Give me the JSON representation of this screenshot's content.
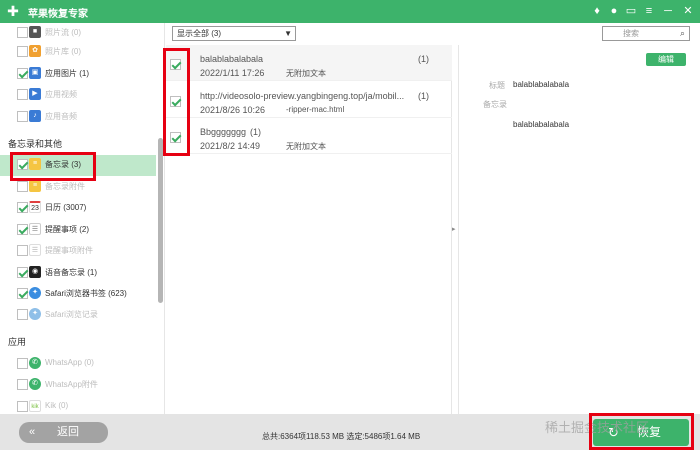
{
  "app": {
    "title": "苹果恢复专家",
    "logo_glyph": "✚"
  },
  "window_controls": [
    {
      "name": "diamond-icon",
      "glyph": "♦"
    },
    {
      "name": "user-icon",
      "glyph": "●"
    },
    {
      "name": "chat-icon",
      "glyph": "▭"
    },
    {
      "name": "menu-icon",
      "glyph": "≡"
    },
    {
      "name": "minimize-icon",
      "glyph": "─"
    },
    {
      "name": "close-icon",
      "glyph": "✕"
    }
  ],
  "sidebar": {
    "items_top": [
      {
        "label": "照片流 (0)",
        "checked": false,
        "enabled": false,
        "icon": "camera-icon",
        "icon_color": "#555555"
      },
      {
        "label": "照片库 (0)",
        "checked": false,
        "enabled": false,
        "icon": "photos-icon",
        "icon_color": "#f0a030"
      },
      {
        "label": "应用图片 (1)",
        "checked": true,
        "enabled": true,
        "icon": "app-images-icon",
        "icon_color": "#3a7bd5"
      },
      {
        "label": "应用视频",
        "checked": false,
        "enabled": false,
        "icon": "app-video-icon",
        "icon_color": "#3a7bd5"
      },
      {
        "label": "应用音频",
        "checked": false,
        "enabled": false,
        "icon": "app-audio-icon",
        "icon_color": "#3a7bd5"
      }
    ],
    "section_memo": "备忘录和其他",
    "items_memo": [
      {
        "label": "备忘录 (3)",
        "checked": true,
        "enabled": true,
        "selected": true,
        "icon": "notes-icon",
        "icon_color": "#f5c542"
      },
      {
        "label": "备忘录附件",
        "checked": false,
        "enabled": false,
        "icon": "notes-attachment-icon",
        "icon_color": "#f5c542"
      },
      {
        "label": "日历 (3007)",
        "checked": true,
        "enabled": true,
        "icon": "calendar-icon",
        "icon_color": "#e04040",
        "icon_text": "23"
      },
      {
        "label": "提醒事项 (2)",
        "checked": true,
        "enabled": true,
        "icon": "reminders-icon",
        "icon_color": "#cccccc"
      },
      {
        "label": "提醒事项附件",
        "checked": false,
        "enabled": false,
        "icon": "reminders-attachment-icon",
        "icon_color": "#cccccc"
      },
      {
        "label": "语音备忘录 (1)",
        "checked": true,
        "enabled": true,
        "icon": "voice-memo-icon",
        "icon_color": "#222222"
      },
      {
        "label": "Safari浏览器书签 (623)",
        "checked": true,
        "enabled": true,
        "icon": "safari-icon",
        "icon_color": "#3a8de0"
      },
      {
        "label": "Safari浏览记录",
        "checked": false,
        "enabled": false,
        "icon": "safari-history-icon",
        "icon_color": "#3a8de0"
      }
    ],
    "section_apps": "应用",
    "items_apps": [
      {
        "label": "WhatsApp (0)",
        "checked": false,
        "enabled": false,
        "icon": "whatsapp-icon",
        "icon_color": "#3db36b"
      },
      {
        "label": "WhatsApp附件",
        "checked": false,
        "enabled": false,
        "icon": "whatsapp-attachment-icon",
        "icon_color": "#3db36b"
      },
      {
        "label": "Kik (0)",
        "checked": false,
        "enabled": false,
        "icon": "kik-icon",
        "icon_color": "#7bc043",
        "icon_text": "kik"
      }
    ]
  },
  "toolbar": {
    "filter_value": "显示全部 (3)",
    "search_placeholder": "搜索"
  },
  "list": [
    {
      "title": "balablabalabala",
      "count": "(1)",
      "date": "2022/1/11 17:26",
      "note": "无附加文本",
      "checked": true
    },
    {
      "title": "http://videosolo-preview.yangbingeng.top/ja/mobil...",
      "count": "(1)",
      "date": "2021/8/26 10:26",
      "note": "-ripper-mac.html",
      "checked": true
    },
    {
      "title": "Bbggggggg",
      "count": "(1)",
      "date": "2021/8/2 14:49",
      "note": "无附加文本",
      "checked": true
    }
  ],
  "detail": {
    "edit_label": "编辑",
    "title_label": "标题",
    "title_value": "balablabalabala",
    "memo_label": "备忘录",
    "memo_value": "balablabalabala"
  },
  "footer": {
    "back_label": "返回",
    "status_text": "总共:6364项118.53 MB 选定:5486项1.64 MB",
    "recover_label": "恢复",
    "watermark": "稀土掘金技术社区"
  },
  "colors": {
    "accent": "#3db36b",
    "highlight": "#e60012",
    "selected_row": "#bfe8cb"
  }
}
